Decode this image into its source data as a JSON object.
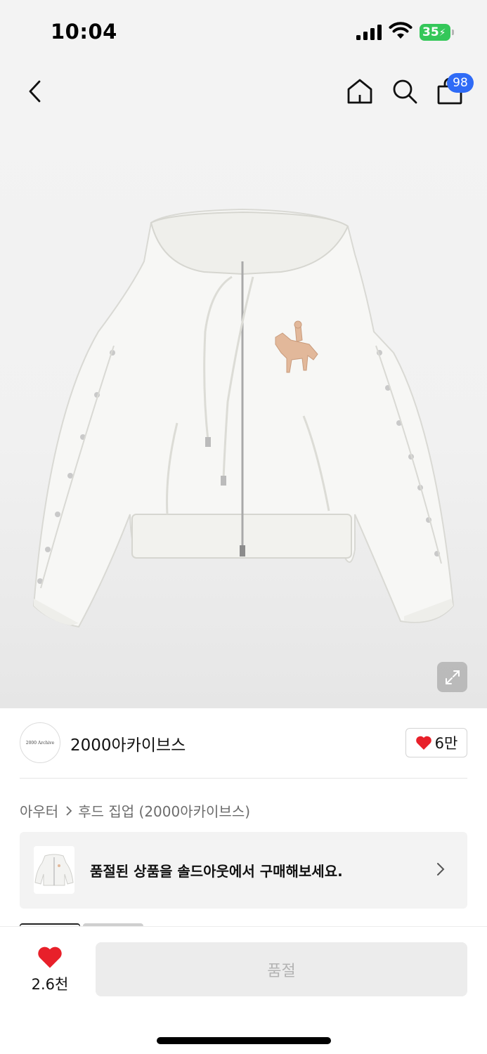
{
  "status_bar": {
    "time": "10:04",
    "battery": "35",
    "battery_color": "#34c759",
    "icons": [
      "cellular-signal-icon",
      "wifi-icon",
      "battery-charging-icon"
    ]
  },
  "nav": {
    "icons": [
      "back-chevron-icon",
      "home-icon",
      "search-icon",
      "shopping-bag-icon"
    ],
    "cart_badge": "98",
    "badge_color": "#2f6bf6"
  },
  "product": {
    "image": "white zip-up hoodie with embroidered horse rider and metal bow clips on sleeves",
    "expand_icon": "expand-arrows-icon"
  },
  "brand": {
    "logo_text": "2000 Archive",
    "name": "2000아카이브스",
    "likes": "6만",
    "like_icon": "heart-icon",
    "accent_color": "#e8202a"
  },
  "breadcrumb": {
    "category": "아우터",
    "subcategory": "후드 집업 (2000아카이브스)"
  },
  "sold_out_banner": {
    "text": "품절된 상품을 솔드아웃에서 구매해보세요."
  },
  "bottom_bar": {
    "wish_count": "2.6천",
    "buy_label": "품절"
  }
}
